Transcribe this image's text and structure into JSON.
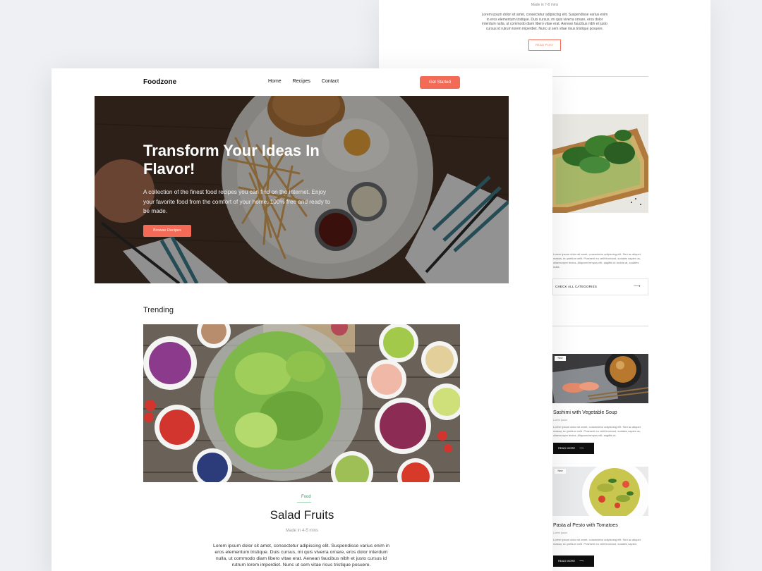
{
  "back_page": {
    "made_in": "Made in 7-8 mins",
    "paragraph": "Lorem ipsum dolor sit amet, consectetur adipiscing elit. Suspendisse varius enim in eros elementum tristique. Duis cursus, mi quis viverra ornare, eros dolor interdum nulla, ut commodo diam libero vitae erat. Aenean faucibus nibh et justo cursus id rutrum lorem imperdiet. Nunc ut sem vitae risus tristique posuere.",
    "read_post": "READ POST",
    "category_text": "Lorem ipsum dolor sit amet, consectetur adipiscing elit. Sed ac aliquet massa, eu pretium velit. Praesent eu velit tincidunt, sodales sapien ac, ullamcorper lectus. Aliquam tempus elit, sagittis ut lacinia at, sodales nulla.",
    "check_categories": "CHECK ALL CATEGORIES",
    "posts": [
      {
        "tag": "New",
        "title": "Sashimi with Vegetable Soup",
        "meta": "Lorem ipsum",
        "body": "Lorem ipsum dolor sit amet, consectetur adipiscing elit. Sed ac aliquet massa, eu pretium velit. Praesent eu velit tincidunt, sodales sapien ac, ullamcorper lectus. Aliquam tempus elit, sagittis ut.",
        "read_more": "READ MORE"
      },
      {
        "tag": "New",
        "title": "Pasta al Pesto with Tomatoes",
        "meta": "Lorem ipsum",
        "body": "Lorem ipsum dolor sit amet, consectetur adipiscing elit. Sed ac aliquet massa, eu pretium velit. Praesent eu velit tincidunt, sodales sapien.",
        "read_more": "READ MORE"
      }
    ]
  },
  "nav": {
    "logo": "Foodzone",
    "links": [
      "Home",
      "Recipes",
      "Contact"
    ],
    "cta": "Get Started"
  },
  "hero": {
    "title": "Transform Your Ideas In Flavor!",
    "description": "A collection of the finest food recipes you can find on the internet. Enjoy your favorite food from the comfort of your home. 100% free and ready to be made.",
    "button": "Browse Recipes"
  },
  "trending": {
    "heading": "Trending",
    "tag": "Food",
    "title": "Salad Fruits",
    "made_in": "Made in 4-5 mins",
    "description": "Lorem ipsum dolor sit amet, consectetur adipiscing elit. Suspendisse varius enim in eros elementum tristique. Duis cursus, mi quis viverra ornare, eros dolor interdum nulla, ut commodo diam libero vitae erat. Aenean faucibus nibh et justo cursus id rutrum lorem imperdiet. Nunc ut sem vitae risus tristique posuere."
  },
  "colors": {
    "accent": "#f36b56",
    "tag_green": "#2e9c5a",
    "dark_button": "#0e0e0e"
  }
}
